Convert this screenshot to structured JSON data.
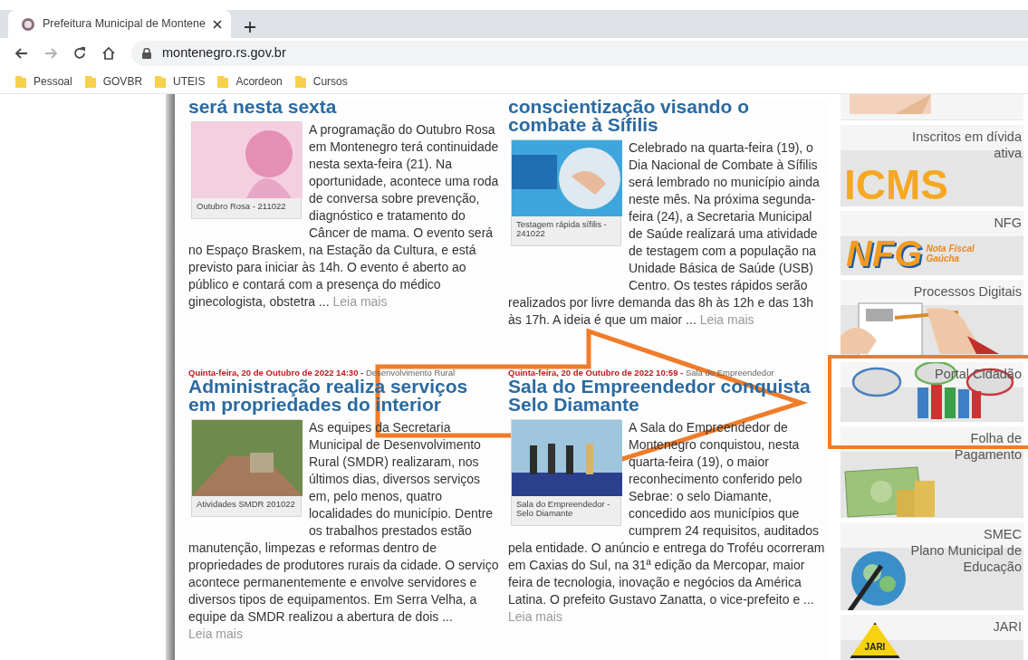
{
  "browser": {
    "tabs": [
      {
        "title": "Prefeitura Municipal de Montene",
        "selected": true
      }
    ],
    "nav_buttons": [
      {
        "kind": "back",
        "disabled": false
      },
      {
        "kind": "forward",
        "disabled": true
      },
      {
        "kind": "reload",
        "disabled": false
      },
      {
        "kind": "home",
        "disabled": false
      }
    ],
    "url": "montenegro.rs.gov.br",
    "bookmarks": [
      "Pessoal",
      "GOVBR",
      "UTEIS",
      "Acordeon",
      "Cursos"
    ]
  },
  "articles": [
    {
      "kind": "poster",
      "title_lines": [
        "será nesta sexta"
      ],
      "caption": "Outubro Rosa - 211022",
      "text_beside": "A programação do Outubro Rosa em Montenegro terá continuidade nesta sexta-feira (21). Na oportunidade, acontece uma roda de conversa sobre prevenção, diagnóstico e tratamento do Câncer de mama. O evento será",
      "text_below": "no Espaço Braskem, na Estação da Cultura, e está previsto para iniciar às 14h. O evento é aberto ao público e contará com a presença do médico ginecologista, obstetra ...",
      "more": "Leia mais"
    },
    {
      "kind": "flyer",
      "title_lines": [
        "conscientização visando o",
        "combate à Sífilis"
      ],
      "caption": "Testagem rápida sífilis - 241022",
      "text_beside": "Celebrado na quarta-feira (19), o Dia Nacional de Combate à Sífilis será lembrado no município ainda neste mês. Na próxima segunda-feira (24), a Secretaria Municipal de Saúde realizará uma atividade de testagem com a população na Unidade Básica de Saúde (USB) Centro. Os testes rápidos serão",
      "text_below": "realizados por livre demanda das 8h às 12h e das 13h às 17h. A ideia é que um maior ...",
      "more": "Leia mais"
    },
    {
      "kind": "road",
      "date": "Quinta-feira, 20 de Outubro de 2022 14:30 -",
      "category": "Desenvolvimento Rural",
      "title_lines": [
        "Administração realiza serviços",
        "em propriedades do interior"
      ],
      "caption": "Atividades SMDR 201022",
      "text_beside": "As equipes da Secretaria Municipal de Desenvolvimento Rural (SMDR) realizaram, nos últimos dias, diversos serviços em, pelo menos, quatro localidades do município. Dentre os trabalhos prestados estão",
      "text_below": "manutenção, limpezas e reformas dentro de propriedades de produtores rurais da cidade. O serviço acontece permanentemente e envolve servidores e diversos tipos de equipamentos.   Em Serra Velha, a equipe da SMDR realizou a abertura de dois ...",
      "more": "Leia mais"
    },
    {
      "kind": "stage",
      "date": "Quinta-feira, 20 de Outubro de 2022 10:59 -",
      "category": "Sala do Empreendedor",
      "title_lines": [
        "Sala do Empreendedor conquista",
        "Selo Diamante"
      ],
      "caption": "Sala do Empreendedor - Selo Diamante",
      "text_beside": "A Sala do Empreendedor de Montenegro conquistou, nesta quarta-feira (19), o maior reconhecimento conferido pelo Sebrae: o selo Diamante, concedido aos municípios que cumprem 24 requisitos, auditados",
      "text_below": "pela entidade.   O anúncio e entrega do Troféu ocorreram em Caxias do Sul, na 31ª edição da Mercopar, maior feira de tecnologia, inovação e negócios da América Latina. O prefeito Gustavo Zanatta, o vice-prefeito e ...",
      "more": "Leia mais"
    }
  ],
  "sidebar": [
    {
      "kind": "hands"
    },
    {
      "kind": "icms",
      "title_lines": [
        "Inscritos em dívida",
        "ativa"
      ],
      "logo_text": "ICMS"
    },
    {
      "kind": "nfg",
      "title_lines": [
        "NFG"
      ],
      "logo_text": "NFG",
      "logo_subtext": [
        "Nota Fiscal",
        "Gaúcha"
      ]
    },
    {
      "kind": "document",
      "title_lines": [
        "Processos Digitais"
      ]
    },
    {
      "kind": "people",
      "title_lines": [
        "Portal Cidadão"
      ]
    },
    {
      "kind": "money",
      "title_lines": [
        "Folha de",
        "Pagamento"
      ]
    },
    {
      "kind": "globe",
      "title_lines": [
        "SMEC",
        "Plano Municipal de",
        "Educação"
      ]
    },
    {
      "kind": "jari",
      "title_lines": [
        "JARI"
      ],
      "logo_text": "JARI"
    }
  ]
}
